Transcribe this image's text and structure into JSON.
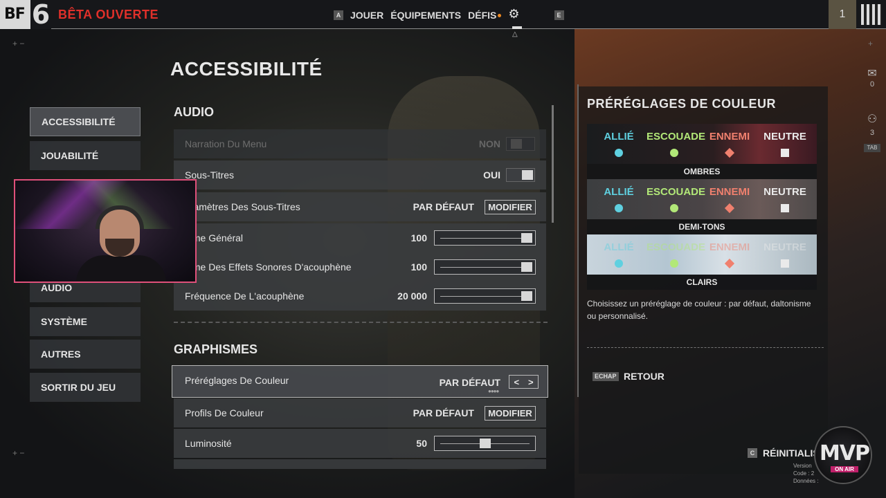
{
  "header": {
    "logo_bf": "BF",
    "logo_six": "6",
    "title": "BÊTA OUVERTE",
    "nav_key_left": "A",
    "nav_items": [
      "JOUER",
      "ÉQUIPEMENTS",
      "DÉFIS"
    ],
    "nav_key_right": "E",
    "player_count": "1"
  },
  "page_title": "ACCESSIBILITÉ",
  "menu": {
    "items": [
      {
        "label": "ACCESSIBILITÉ",
        "active": true
      },
      {
        "label": "JOUABILITÉ"
      },
      {
        "label": "AUDIO"
      },
      {
        "label": "SYSTÈME"
      },
      {
        "label": "AUTRES"
      },
      {
        "label": "SORTIR DU JEU"
      }
    ]
  },
  "sections": {
    "audio_title": "AUDIO",
    "graphismes_title": "GRAPHISMES"
  },
  "audio_rows": [
    {
      "label": "Narration Du Menu",
      "value": "NON",
      "control": "toggle",
      "disabled": true
    },
    {
      "label": "Sous-Titres",
      "value": "OUI",
      "control": "toggle"
    },
    {
      "label": "aramètres Des Sous-Titres",
      "value": "PAR DÉFAUT",
      "control": "button",
      "button": "MODIFIER"
    },
    {
      "label": "lume Général",
      "value": "100",
      "control": "slider",
      "level": 1.0
    },
    {
      "label": "lume Des Effets Sonores D'acouphène",
      "value": "100",
      "control": "slider",
      "level": 1.0
    },
    {
      "label": "Fréquence De L'acouphène",
      "value": "20 000",
      "control": "slider",
      "level": 1.0
    }
  ],
  "graphismes_rows": [
    {
      "label": "Préréglages De Couleur",
      "value": "PAR DÉFAUT",
      "control": "arrows",
      "selected": true
    },
    {
      "label": "Profils De Couleur",
      "value": "PAR DÉFAUT",
      "control": "button",
      "button": "MODIFIER"
    },
    {
      "label": "Luminosité",
      "value": "50",
      "control": "slider",
      "level": 0.5
    }
  ],
  "right_panel": {
    "title": "PRÉRÉGLAGES DE COULEUR",
    "columns": [
      "ALLIÉ",
      "ESCOUADE",
      "ENNEMI",
      "NEUTRE"
    ],
    "presets": [
      "OMBRES",
      "DEMI-TONS",
      "CLAIRS"
    ],
    "description": "Choisissez un préréglage de couleur : par défaut, daltonisme ou personnalisé.",
    "back_key": "ECHAP",
    "back_label": "RETOUR"
  },
  "side": {
    "mail_count": "0",
    "squad_count": "3",
    "tab_key": "TAB"
  },
  "footer": {
    "reset_key": "C",
    "reset_label": "RÉINITIALIS",
    "mvp_text": "MVP",
    "mvp_onair": "ON AIR",
    "version_lines": [
      "Version",
      "Code : 2",
      "Données :"
    ]
  },
  "colors": {
    "ally": "#5fd0e0",
    "squad": "#b2e878",
    "enemy": "#f0806e",
    "neutral": "#eaeaea",
    "brand_red": "#e0302a",
    "webcam_border": "#e0507a"
  }
}
